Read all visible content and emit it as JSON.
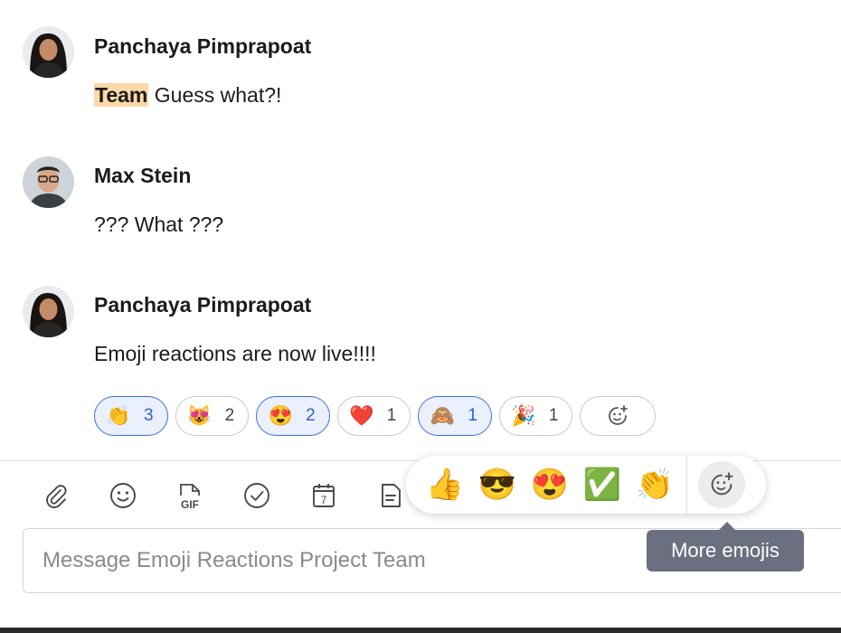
{
  "messages": [
    {
      "author": "Panchaya Pimprapoat",
      "mention": "Team",
      "text": " Guess what?!"
    },
    {
      "author": "Max Stein",
      "text": "??? What ???"
    },
    {
      "author": "Panchaya Pimprapoat",
      "text": "Emoji reactions are now live!!!!"
    }
  ],
  "reactions": [
    {
      "emoji": "👏",
      "count": "3",
      "selected": true
    },
    {
      "emoji": "😻",
      "count": "2",
      "selected": false
    },
    {
      "emoji": "😍",
      "count": "2",
      "selected": true
    },
    {
      "emoji": "❤️",
      "count": "1",
      "selected": false
    },
    {
      "emoji": "🙈",
      "count": "1",
      "selected": true
    },
    {
      "emoji": "🎉",
      "count": "1",
      "selected": false
    }
  ],
  "add_reaction_icon": "add-emoji-icon",
  "toolbar": {
    "icons": [
      "attachment-icon",
      "emoji-icon",
      "gif-icon",
      "check-circle-icon",
      "calendar-icon",
      "document-icon"
    ],
    "gif_label": "GIF",
    "calendar_day": "7"
  },
  "quick_emojis": [
    "👍",
    "😎",
    "😍",
    "✅",
    "👏"
  ],
  "tooltip": "More emojis",
  "composer": {
    "placeholder": "Message Emoji Reactions Project Team"
  },
  "colors": {
    "selected_border": "#3f6ee0",
    "selected_bg": "#eaf1fd",
    "mention_bg": "#fdd9a8",
    "tooltip_bg": "#6b6f80"
  }
}
